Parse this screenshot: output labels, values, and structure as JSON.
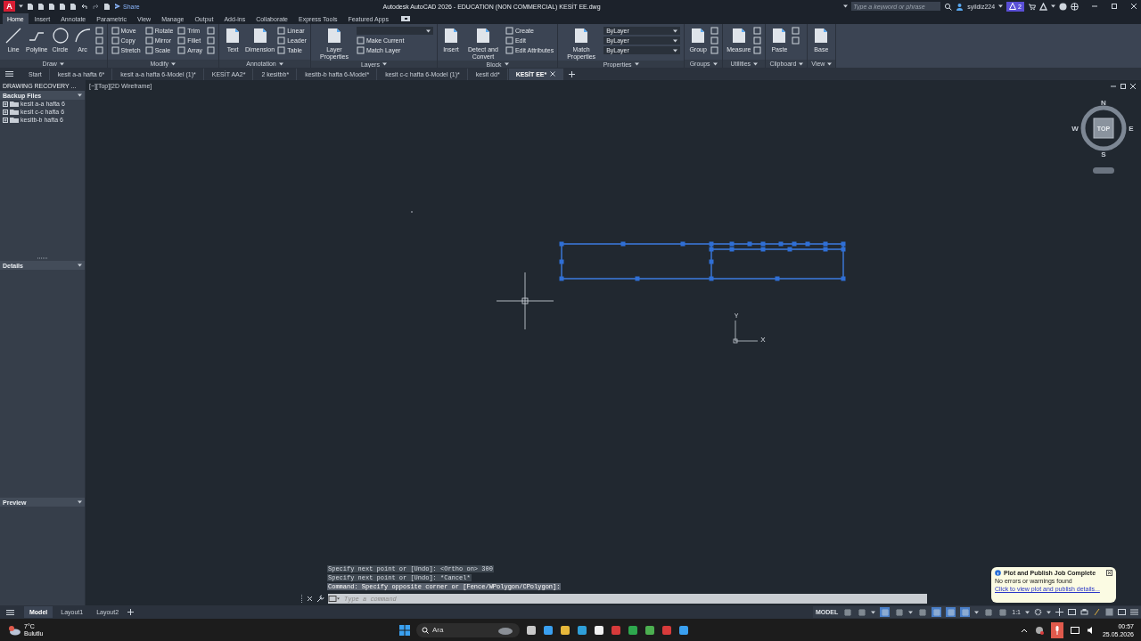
{
  "title_bar": {
    "logo": "A",
    "share": "Share",
    "title": "Autodesk AutoCAD 2026 - EDUCATION (NON COMMERCIAL)    KESİT EE.dwg",
    "search": {
      "placeholder": "Type a keyword or phrase"
    },
    "user": "syildiz224",
    "alert_count": "2"
  },
  "ribbon_tabs": [
    {
      "label": "Home",
      "selected": true
    },
    {
      "label": "Insert",
      "selected": false
    },
    {
      "label": "Annotate",
      "selected": false
    },
    {
      "label": "Parametric",
      "selected": false
    },
    {
      "label": "View",
      "selected": false
    },
    {
      "label": "Manage",
      "selected": false
    },
    {
      "label": "Output",
      "selected": false
    },
    {
      "label": "Add-ins",
      "selected": false
    },
    {
      "label": "Collaborate",
      "selected": false
    },
    {
      "label": "Express Tools",
      "selected": false
    },
    {
      "label": "Featured Apps",
      "selected": false
    }
  ],
  "ribbon_panels": [
    {
      "title": "Draw",
      "tools": [
        {
          "kind": "large",
          "label": "Line"
        },
        {
          "kind": "large",
          "label": "Polyline"
        },
        {
          "kind": "large",
          "label": "Circle"
        },
        {
          "kind": "large",
          "label": "Arc"
        },
        {
          "kind": "icon"
        },
        {
          "kind": "icon"
        },
        {
          "kind": "icon"
        }
      ]
    },
    {
      "title": "Modify",
      "tools": [
        {
          "kind": "small",
          "label": "Move"
        },
        {
          "kind": "small",
          "label": "Copy"
        },
        {
          "kind": "small",
          "label": "Stretch"
        },
        {
          "kind": "small",
          "label": "Rotate"
        },
        {
          "kind": "small",
          "label": "Mirror"
        },
        {
          "kind": "small",
          "label": "Scale"
        },
        {
          "kind": "small",
          "label": "Trim"
        },
        {
          "kind": "small",
          "label": "Fillet"
        },
        {
          "kind": "small",
          "label": "Array"
        },
        {
          "kind": "icon"
        },
        {
          "kind": "icon"
        },
        {
          "kind": "icon"
        }
      ]
    },
    {
      "title": "Annotation",
      "tools": [
        {
          "kind": "large",
          "label": "Text"
        },
        {
          "kind": "large",
          "label": "Dimension"
        },
        {
          "kind": "small",
          "label": "Linear"
        },
        {
          "kind": "small",
          "label": "Leader"
        },
        {
          "kind": "small",
          "label": "Table"
        }
      ]
    },
    {
      "title": "Layers",
      "tools": [
        {
          "kind": "large",
          "label": "Layer Properties"
        },
        {
          "kind": "dropdown"
        },
        {
          "kind": "small",
          "label": "Make Current"
        },
        {
          "kind": "small",
          "label": "Match Layer"
        }
      ]
    },
    {
      "title": "Block",
      "tools": [
        {
          "kind": "large",
          "label": "Insert"
        },
        {
          "kind": "large",
          "label": "Detect and Convert"
        },
        {
          "kind": "small",
          "label": "Create"
        },
        {
          "kind": "small",
          "label": "Edit"
        },
        {
          "kind": "small",
          "label": "Edit Attributes"
        }
      ]
    },
    {
      "title": "Properties",
      "tools": [
        {
          "kind": "large",
          "label": "Match Properties"
        },
        {
          "kind": "dropdown",
          "label": "ByLayer"
        },
        {
          "kind": "dropdown",
          "label": "ByLayer"
        },
        {
          "kind": "dropdown",
          "label": "ByLayer"
        }
      ]
    },
    {
      "title": "Groups",
      "tools": [
        {
          "kind": "large",
          "label": "Group"
        },
        {
          "kind": "icon"
        },
        {
          "kind": "icon"
        },
        {
          "kind": "icon"
        }
      ]
    },
    {
      "title": "Utilities",
      "tools": [
        {
          "kind": "large",
          "label": "Measure"
        },
        {
          "kind": "icon"
        },
        {
          "kind": "icon"
        },
        {
          "kind": "icon"
        }
      ]
    },
    {
      "title": "Clipboard",
      "tools": [
        {
          "kind": "large",
          "label": "Paste"
        },
        {
          "kind": "icon"
        },
        {
          "kind": "icon"
        }
      ]
    },
    {
      "title": "View",
      "tools": [
        {
          "kind": "large",
          "label": "Base"
        }
      ]
    }
  ],
  "file_tabs": [
    {
      "label": "Start",
      "selected": false
    },
    {
      "label": "kesit a-a  hafta 6*",
      "selected": false
    },
    {
      "label": "kesit a-a  hafta 6-Model (1)*",
      "selected": false
    },
    {
      "label": "KESİT AA2*",
      "selected": false
    },
    {
      "label": "2 kesitbb*",
      "selected": false
    },
    {
      "label": "kesitb-b hafta 6-Model*",
      "selected": false
    },
    {
      "label": "kesit c-c hafta 6-Model (1)*",
      "selected": false
    },
    {
      "label": "kesit dd*",
      "selected": false
    },
    {
      "label": "KESİT EE*",
      "selected": true
    }
  ],
  "side_panel": {
    "title": "DRAWING RECOVERY ...",
    "backup_files": {
      "title": "Backup Files",
      "items": [
        {
          "label": "kesit a-a  hafta 6",
          "expanded": false
        },
        {
          "label": "kesit c-c hafta 6",
          "expanded": false
        },
        {
          "label": "kesitb-b hafta 6",
          "expanded": false
        }
      ]
    },
    "details": "Details",
    "preview": "Preview"
  },
  "viewport": {
    "label": "[−][Top][2D Wireframe]",
    "viewcube": {
      "north": "N",
      "south": "S",
      "east": "E",
      "west": "W",
      "face": "TOP"
    },
    "ucs": {
      "x": "X",
      "y": "Y"
    }
  },
  "command": {
    "history": [
      "Specify next point or [Undo]:  <Ortho on> 300",
      "Specify next point or [Undo]: *Cancel*",
      "Command: Specify opposite corner or [Fence/WPolygon/CPolygon]:"
    ],
    "input": {
      "placeholder": "Type a command"
    }
  },
  "notification": {
    "title": "Plot and Publish Job Complete",
    "message": "No errors or warnings found",
    "link": "Click to view plot and publish details..."
  },
  "layout_tabs": [
    {
      "label": "Model",
      "selected": true
    },
    {
      "label": "Layout1",
      "selected": false
    },
    {
      "label": "Layout2",
      "selected": false
    }
  ],
  "status_bar": {
    "space": "MODEL",
    "scale": "1:1",
    "toggles": [
      {
        "on": false
      },
      {
        "on": false
      },
      {
        "on": true
      },
      {
        "on": false
      },
      {
        "on": false
      },
      {
        "on": true
      },
      {
        "on": true
      },
      {
        "on": true
      },
      {
        "on": false
      },
      {
        "on": false
      }
    ]
  },
  "taskbar": {
    "weather": {
      "temperature": "7°C",
      "condition": "Bulutlu"
    },
    "search": {
      "placeholder": "Ara"
    },
    "time": "00:57",
    "date": "25.05.2026"
  }
}
